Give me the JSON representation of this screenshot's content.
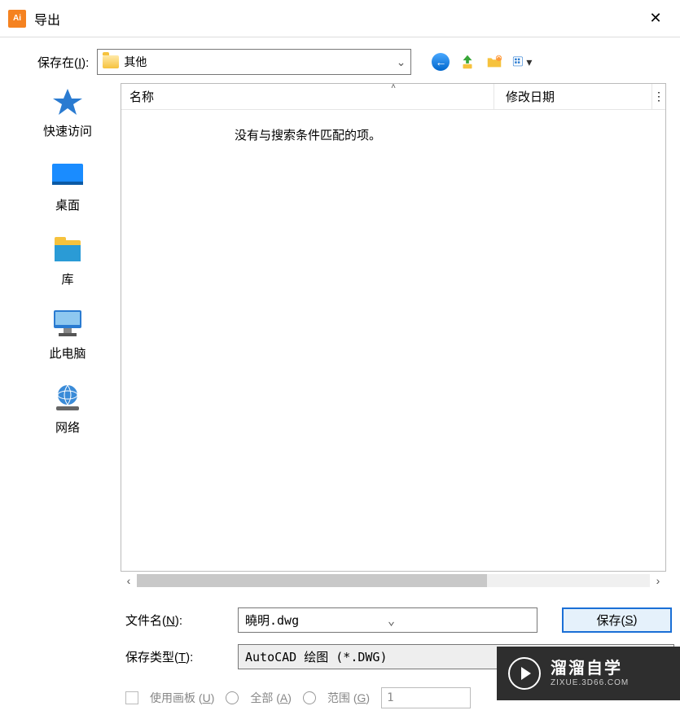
{
  "window": {
    "title": "导出",
    "close_glyph": "✕"
  },
  "location": {
    "label_pre": "保存在(",
    "label_key": "I",
    "label_post": "):",
    "value": "其他",
    "chevron": "⌄"
  },
  "toolbar": {
    "back_arrow": "←",
    "views_chevron": "▾"
  },
  "places": [
    {
      "label": "快速访问",
      "icon": "quick-access"
    },
    {
      "label": "桌面",
      "icon": "desktop"
    },
    {
      "label": "库",
      "icon": "libraries"
    },
    {
      "label": "此电脑",
      "icon": "this-pc"
    },
    {
      "label": "网络",
      "icon": "network"
    }
  ],
  "columns": {
    "name": "名称",
    "date": "修改日期",
    "sort_caret": "˄",
    "extra": "⋮"
  },
  "list": {
    "empty_message": "没有与搜索条件匹配的项。"
  },
  "scrollbar": {
    "left": "‹",
    "right": "›"
  },
  "fields": {
    "file_name_label_pre": "文件名(",
    "file_name_key": "N",
    "file_name_label_post": "):",
    "file_name_value": "曉明.dwg",
    "file_name_chevron": "⌄",
    "file_type_label_pre": "保存类型(",
    "file_type_key": "T",
    "file_type_label_post": "):",
    "file_type_value": "AutoCAD 绘图 (*.DWG)",
    "save_button_pre": "保存(",
    "save_button_key": "S",
    "save_button_post": ")"
  },
  "options": {
    "use_artboard_pre": "使用画板 (",
    "use_artboard_key": "U",
    "use_artboard_post": ")",
    "all_pre": "全部 (",
    "all_key": "A",
    "all_post": ")",
    "range_pre": "范围 (",
    "range_key": "G",
    "range_post": ")",
    "range_value": "1"
  },
  "watermark": {
    "main": "溜溜自学",
    "sub": "ZIXUE.3D66.COM"
  }
}
